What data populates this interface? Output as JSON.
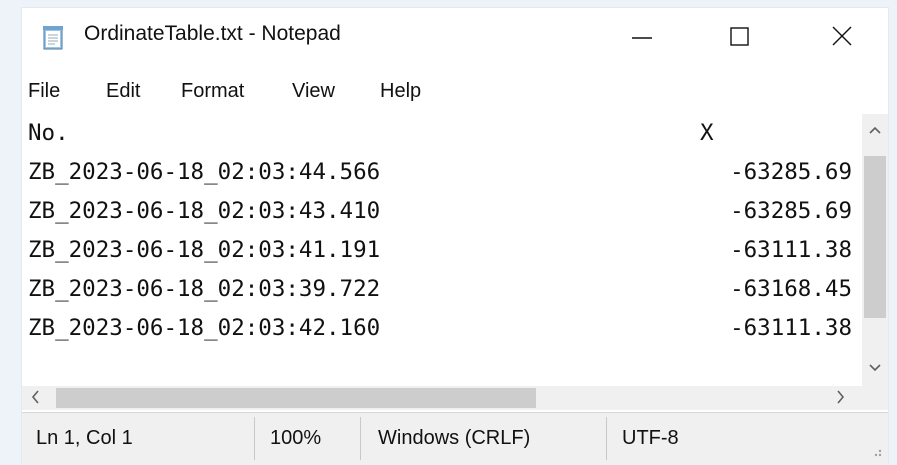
{
  "window": {
    "title": "OrdinateTable.txt - Notepad",
    "icon": "notepad-icon",
    "controls": {
      "minimize": "minimize-icon",
      "maximize": "maximize-icon",
      "close": "close-icon"
    }
  },
  "menu": {
    "items": [
      {
        "label": "File"
      },
      {
        "label": "Edit"
      },
      {
        "label": "Format"
      },
      {
        "label": "View"
      },
      {
        "label": "Help"
      }
    ]
  },
  "document": {
    "columns": [
      "No.",
      "X"
    ],
    "rows": [
      {
        "no": "ZB_2023-06-18_02:03:44.566",
        "x": "-63285.69"
      },
      {
        "no": "ZB_2023-06-18_02:03:43.410",
        "x": "-63285.69"
      },
      {
        "no": "ZB_2023-06-18_02:03:41.191",
        "x": "-63111.38"
      },
      {
        "no": "ZB_2023-06-18_02:03:39.722",
        "x": "-63168.45"
      },
      {
        "no": "ZB_2023-06-18_02:03:42.160",
        "x": "-63111.38"
      }
    ]
  },
  "status": {
    "position": "Ln 1, Col 1",
    "zoom": "100%",
    "line_ending": "Windows (CRLF)",
    "encoding": "UTF-8"
  },
  "scrollbars": {
    "up_arrow": "^",
    "down_arrow": "v",
    "left_arrow": "<",
    "right_arrow": ">"
  },
  "colors": {
    "background": "#eef2f9",
    "window": "#ffffff",
    "chrome": "#f0f0f0",
    "scroll_thumb": "#cdcdcd"
  }
}
